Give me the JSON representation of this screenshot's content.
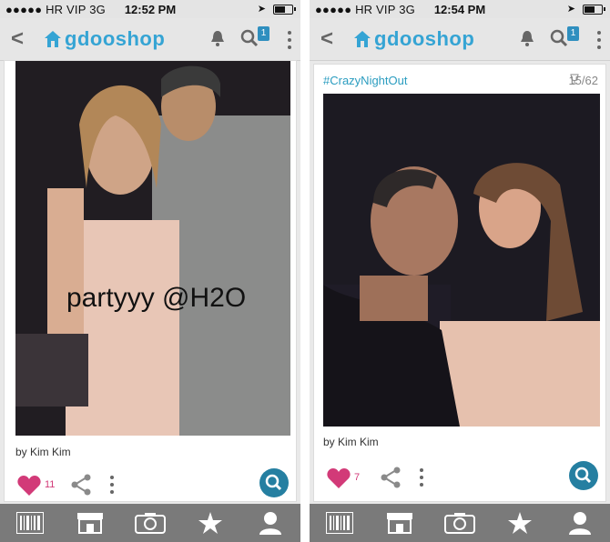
{
  "screens": [
    {
      "status": {
        "carrier": "●●●●● HR VIP  3G",
        "time": "12:52 PM"
      },
      "app": {
        "logo_text": "gdooshop",
        "search_badge": "1"
      },
      "post": {
        "hashtag": "",
        "votes": "",
        "photo_caption": "partyyy @H2O",
        "byline": "by Kim Kim",
        "likes": "11"
      }
    },
    {
      "status": {
        "carrier": "●●●●● HR VIP  3G",
        "time": "12:54 PM"
      },
      "app": {
        "logo_text": "gdooshop",
        "search_badge": "1"
      },
      "post": {
        "hashtag": "#CrazyNightOut",
        "votes": "15/62",
        "photo_caption": "",
        "byline": "by Kim Kim",
        "likes": "7"
      }
    }
  ],
  "colors": {
    "accent": "#35a4d4",
    "like": "#d23a78",
    "fab": "#257fa1"
  },
  "icons": [
    "back-arrow-icon",
    "house-logo-icon",
    "bell-icon",
    "search-icon",
    "more-vertical-icon",
    "heart-icon",
    "share-icon",
    "barcode-icon",
    "store-icon",
    "camera-icon",
    "star-icon",
    "user-icon"
  ]
}
